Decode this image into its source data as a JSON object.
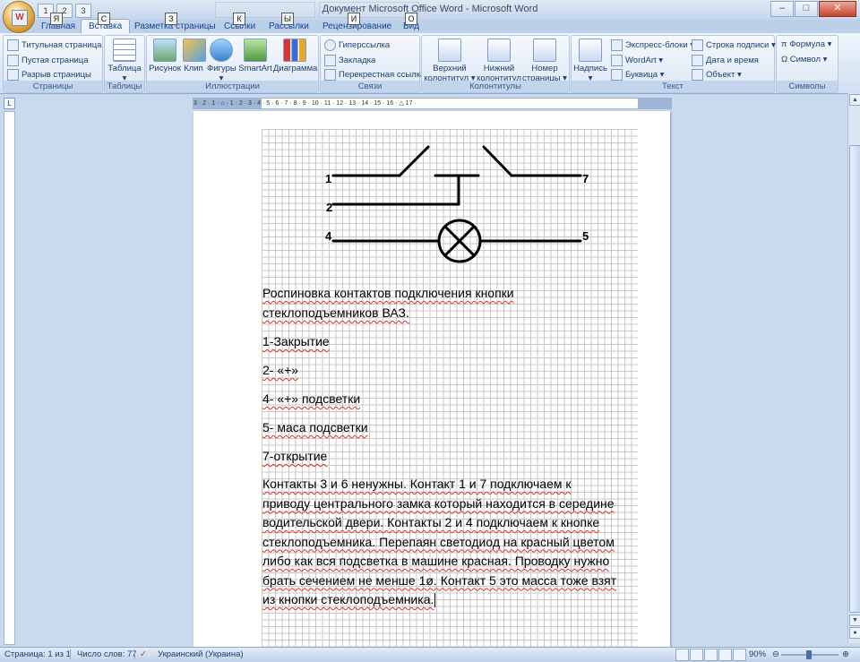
{
  "window": {
    "title": "Документ Microsoft Office Word - Microsoft Word",
    "qat_keytips": [
      "1",
      "2",
      "3"
    ],
    "controls": [
      "–",
      "□",
      "✕"
    ]
  },
  "tabs": [
    {
      "label": "Главная",
      "keytip": "Я"
    },
    {
      "label": "Вставка",
      "keytip": "С",
      "active": true
    },
    {
      "label": "Разметка страницы",
      "keytip": "З"
    },
    {
      "label": "Ссылки",
      "keytip": "К"
    },
    {
      "label": "Рассылки",
      "keytip": "Ы"
    },
    {
      "label": "Рецензирование",
      "keytip": "И"
    },
    {
      "label": "Вид",
      "keytip": "О"
    }
  ],
  "ribbon": {
    "pages": {
      "label": "Страницы",
      "items": [
        "Титульная страница ▾",
        "Пустая страница",
        "Разрыв страницы"
      ]
    },
    "tables": {
      "label": "Таблицы",
      "items": [
        "Таблица"
      ]
    },
    "illustrations": {
      "label": "Иллюстрации",
      "items": [
        "Рисунок",
        "Клип",
        "Фигуры",
        "SmartArt",
        "Диаграмма"
      ]
    },
    "links": {
      "label": "Связи",
      "items": [
        "Гиперссылка",
        "Закладка",
        "Перекрестная ссылка"
      ]
    },
    "header_footer": {
      "label": "Колонтитулы",
      "items": [
        "Верхний колонтитул ▾",
        "Нижний колонтитул ▾",
        "Номер страницы ▾"
      ]
    },
    "text": {
      "label": "Текст",
      "items": [
        "Надпись",
        "Экспресс-блоки ▾",
        "WordArt ▾",
        "Буквица ▾",
        "Строка подписи ▾",
        "Дата и время",
        "Объект ▾"
      ]
    },
    "symbols": {
      "label": "Символы",
      "items": [
        "π Формула ▾",
        "Ω Символ ▾"
      ]
    }
  },
  "ruler": {
    "numbers": "3 · 2 · 1 · ⌂ · 1 · 2 · 3 · 4 · 5 · 6 · 7 · 8 · 9 · 10 · 11 · 12 · 13 · 14 · 15 · 16 · △ 17 ·"
  },
  "schematic": {
    "pin_labels": [
      "1",
      "2",
      "4",
      "5",
      "7"
    ]
  },
  "document": {
    "paragraphs": [
      "Роспиновка контактов подключения кнопки стеклоподъемников ВАЗ.",
      "1-Закрытие",
      "2- «+»",
      "4- «+» подсветки",
      "5- маса подсветки",
      "7-открытие",
      "Контакты 3 и 6 ненужны. Контакт 1 и 7 подключаем к приводу центрального замка который находится в середине водительской двери. Контакты 2 и 4 подключаем к кнопке стеклоподъемника. Перепаян светодиод на красный цветом либо как вся подсветка в машине красная. Проводку нужно брать сечением не менше 1ø. Контакт 5 это масса тоже взят из кнопки стеклоподъемника."
    ]
  },
  "status": {
    "page": "Страница: 1 из 1",
    "words": "Число слов: 77",
    "language": "Украинский (Украина)",
    "zoom": "90%"
  }
}
